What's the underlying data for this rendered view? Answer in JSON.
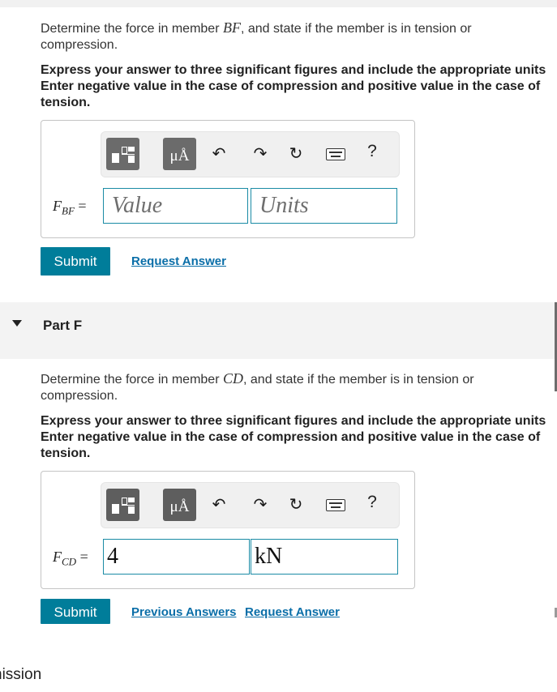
{
  "part_e": {
    "question_pre": "Determine the force in member ",
    "question_member": "BF",
    "question_post": ", and state if the member is in tension or",
    "question_line2": "compression.",
    "instruction_line1": "Express your answer to three significant figures and include the appropriate units",
    "instruction_line2": "Enter negative value in the case of compression and positive value in the case of",
    "instruction_line3": "tension.",
    "var_main": "F",
    "var_sub": "BF",
    "equals": "=",
    "value_placeholder": "Value",
    "units_placeholder": "Units",
    "submit_label": "Submit",
    "request_answer_label": "Request Answer"
  },
  "part_f": {
    "header_label": "Part F",
    "question_pre": "Determine the force in member ",
    "question_member": "CD",
    "question_post": ", and state if the member is in tension or",
    "question_line2": "compression.",
    "instruction_line1": "Express your answer to three significant figures and include the appropriate units",
    "instruction_line2": "Enter negative value in the case of compression and positive value in the case of",
    "instruction_line3": "tension.",
    "var_main": "F",
    "var_sub": "CD",
    "equals": "=",
    "value_text": "4",
    "units_text": "kN",
    "submit_label": "Submit",
    "previous_answers_label": "Previous Answers",
    "request_answer_label": "Request Answer"
  },
  "toolbar": {
    "templates_icon": "templates-icon",
    "units_icon_text": "μÅ",
    "undo_icon": "↶",
    "redo_icon": "↷",
    "reset_icon": "↻",
    "keyboard_icon": "keyboard-icon",
    "help_icon": "?"
  },
  "footer": {
    "truncated_text": "nission"
  },
  "colors": {
    "accent": "#007d9a",
    "link": "#0a6ea8",
    "input_border": "#1a8ba5",
    "toolbar_button": "#6b6b6b"
  }
}
